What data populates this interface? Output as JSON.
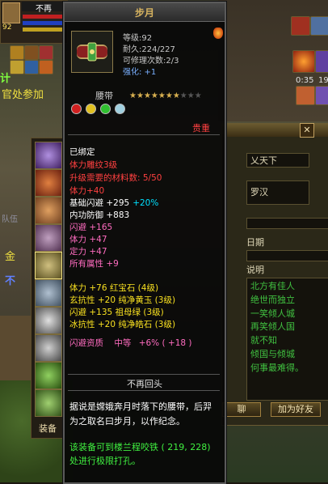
{
  "game_bg": {
    "player_name": "不再",
    "player_level": "92",
    "npc_text_1": "官处参加",
    "npc_text_2": "计",
    "side_text_1": "队伍",
    "side_text_2": "金",
    "side_text_3": "不",
    "timer_1": "0:35",
    "timer_2": "19"
  },
  "tooltip": {
    "title": "步月",
    "level": "等级:92",
    "durability": "耐久:224/227",
    "repairs": "可修理次数:2/3",
    "enhance": "强化: +1",
    "item_type": "腰带",
    "weight_label": "贵重",
    "stars_filled": 7,
    "stars_total": 10,
    "bound": "已绑定",
    "sealed": "体力雕纹3级",
    "upgrade_materials": "升级需要的材料数: 5/50",
    "attr_lines": [
      {
        "text": "体力+40",
        "color": "red"
      },
      {
        "text": "基础闪避 +295",
        "extra": "+20%",
        "color": "white"
      },
      {
        "text": "内功防御 +883",
        "color": "white"
      },
      {
        "text": "闪避 +165",
        "color": "pink"
      },
      {
        "text": "体力 +47",
        "color": "pink"
      },
      {
        "text": "定力 +47",
        "color": "pink"
      },
      {
        "text": "所有属性 +9",
        "color": "pink"
      }
    ],
    "gem_lines": [
      {
        "text": "体力 +76 红宝石 (4级)",
        "color": "gold"
      },
      {
        "text": "玄抗性 +20 纯净黄玉 (3级)",
        "color": "gold"
      },
      {
        "text": "闪避 +135 祖母绿 (3级)",
        "color": "gold"
      },
      {
        "text": "冰抗性 +20 纯净皓石 (3级)",
        "color": "gold"
      }
    ],
    "aptitude_label": "闪避资质",
    "aptitude_grade": "中等",
    "aptitude_value": "+6% ( +18 )",
    "set_name": "不再回头",
    "description": "据说是嫦娥奔月时落下的腰带，后羿为之取名曰步月，以作纪念。",
    "socket_hint": "该装备可到楼兰程咬铁 ( 219, 228) 处进行极限打孔。"
  },
  "right_panel": {
    "close_label": "✕",
    "name_value": "乂天下",
    "title_value": "罗汉",
    "date_label": "日期",
    "desc_label": "说明",
    "poem_lines": [
      "北方有佳人",
      "绝世而独立",
      "一笑倾人城",
      "再笑倾人国",
      "就不知",
      "倾国与倾城",
      "何事最难得。"
    ],
    "chat_label": "聊",
    "add_friend_label": "加为好友"
  },
  "equip_column": {
    "label": "装备"
  },
  "colors": {
    "title_gold": "#d8b460",
    "red": "#ff4040",
    "pink": "#ff6cc0",
    "gold": "#f8e020",
    "cyan": "#00e0ff",
    "green": "#40f040"
  }
}
